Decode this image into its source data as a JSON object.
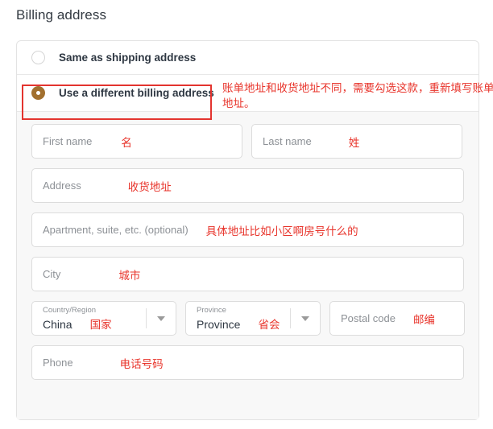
{
  "page": {
    "title": "Billing address"
  },
  "billing_options": [
    {
      "label": "Same as shipping address",
      "selected": false,
      "icon": "radio-unchecked-icon"
    },
    {
      "label": "Use a different billing address",
      "selected": true,
      "icon": "radio-checked-icon"
    }
  ],
  "annotations": {
    "billing_option_note": "账单地址和收货地址不同，需要勾选这款，重新填写账单地址。",
    "highlight_color": "#e3342f",
    "note_color": "#e8342b"
  },
  "form": {
    "first_name": {
      "placeholder": "First name",
      "note": "名",
      "value": ""
    },
    "last_name": {
      "placeholder": "Last name",
      "note": "姓",
      "value": ""
    },
    "address": {
      "placeholder": "Address",
      "note": "收货地址",
      "value": ""
    },
    "apartment": {
      "placeholder": "Apartment, suite, etc. (optional)",
      "note": "具体地址比如小区啊房号什么的",
      "value": ""
    },
    "city": {
      "placeholder": "City",
      "note": "城市",
      "value": ""
    },
    "country": {
      "label": "Country/Region",
      "value": "China",
      "note": "国家",
      "icon": "chevron-down-icon"
    },
    "province": {
      "label": "Province",
      "value": "Province",
      "note": "省会",
      "icon": "chevron-down-icon"
    },
    "postal_code": {
      "placeholder": "Postal code",
      "note": "邮编",
      "value": ""
    },
    "phone": {
      "placeholder": "Phone",
      "note": "电话号码",
      "value": ""
    }
  },
  "colors": {
    "radio_selected": "#a2702f",
    "panel_bg": "#f8f8f8",
    "field_border": "#dcdcdc",
    "text": "#2e3742",
    "placeholder": "#8d9196"
  }
}
